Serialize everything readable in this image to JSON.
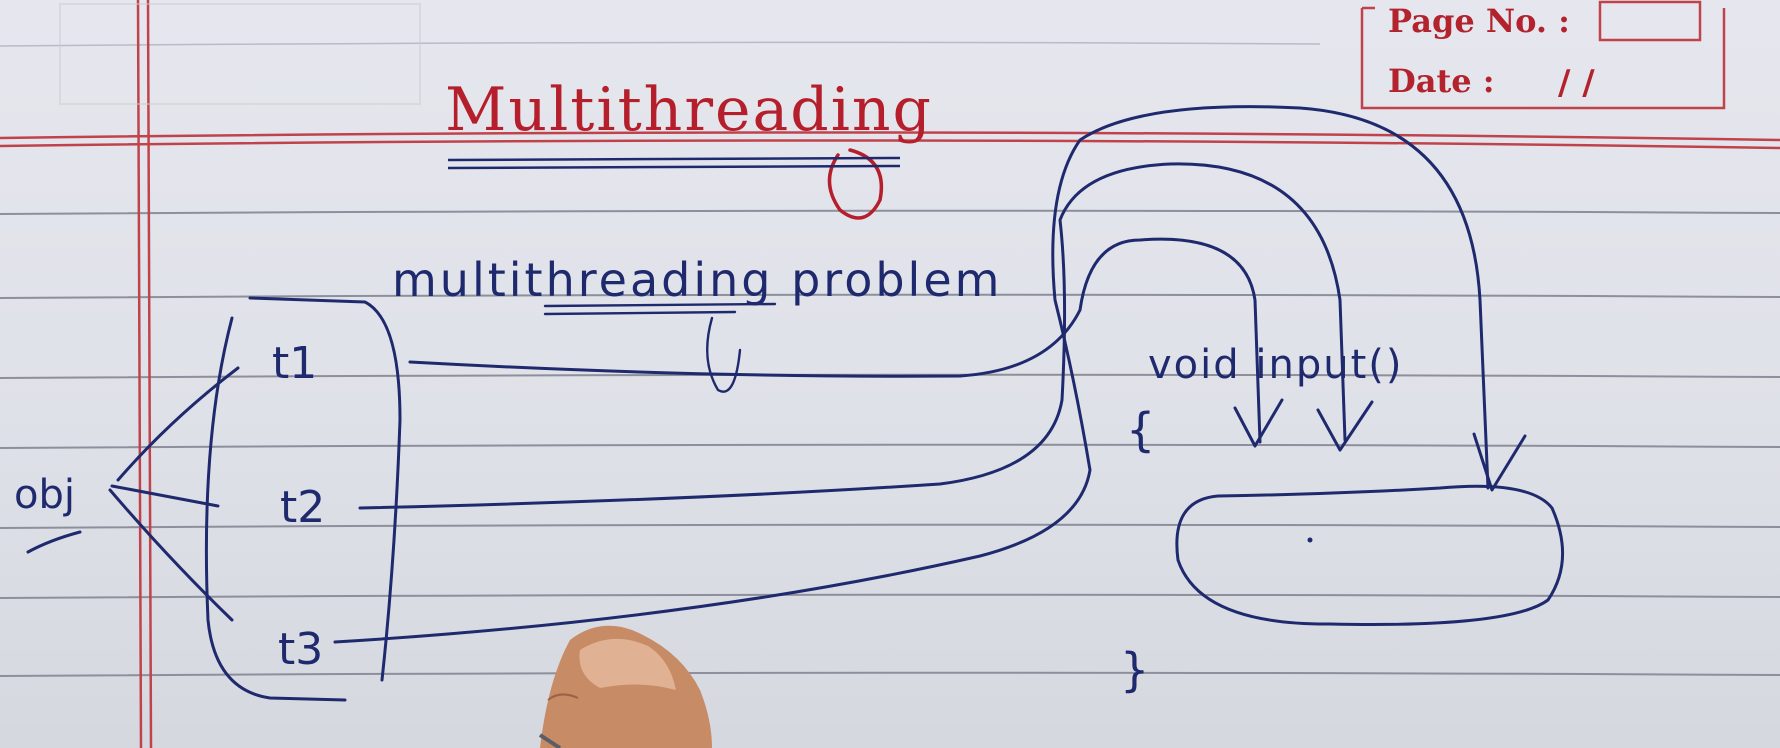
{
  "header": {
    "page_no_label": "Page No. :",
    "date_label": "Date :",
    "date_separators": "/  /"
  },
  "title": "Multithreading",
  "subtitle": "multithreading problem",
  "threads": [
    "t1",
    "t2",
    "t3"
  ],
  "object_label": "obj",
  "method": {
    "signature": "void input()",
    "open_brace": "{",
    "close_brace": "}"
  },
  "colors": {
    "ink_blue": "#1f2a6e",
    "margin_red": "#c0434c",
    "title_red": "#b51f2c",
    "paper": "#e3e4eb",
    "rule_line": "#8d8f9c"
  }
}
